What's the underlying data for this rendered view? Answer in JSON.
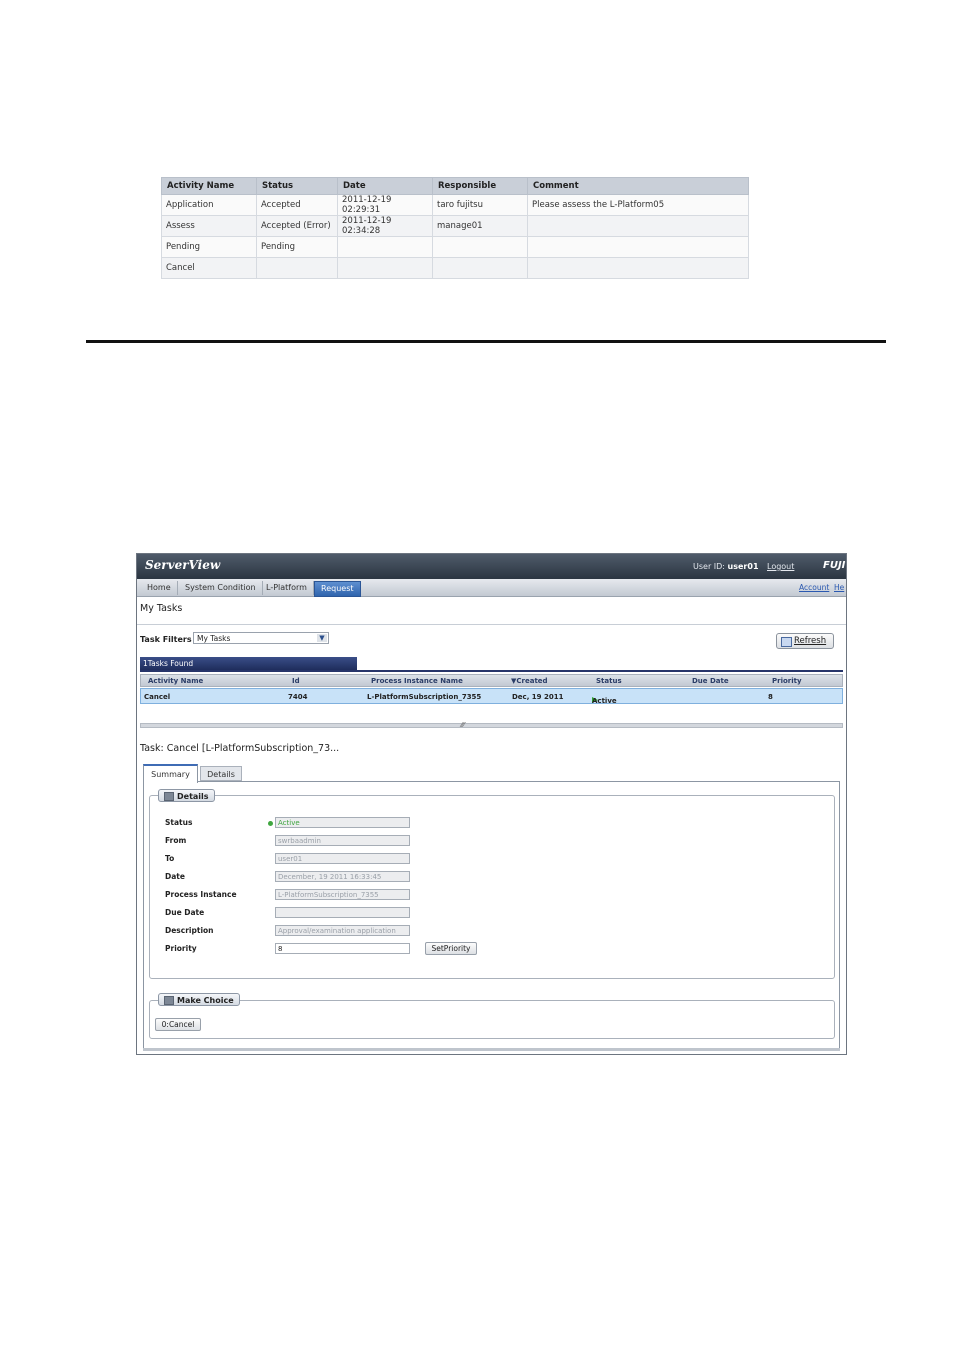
{
  "history": {
    "headers": [
      "Activity Name",
      "Status",
      "Date",
      "Responsible",
      "Comment"
    ],
    "rows": [
      [
        "Application",
        "Accepted",
        "2011-12-19 02:29:31",
        "taro fujitsu",
        "Please assess the L-Platform05"
      ],
      [
        "Assess",
        "Accepted (Error)",
        "2011-12-19 02:34:28",
        "manage01",
        ""
      ],
      [
        "Pending",
        "Pending",
        "",
        "",
        ""
      ],
      [
        "Cancel",
        "",
        "",
        "",
        ""
      ]
    ]
  },
  "app": {
    "logo": "ServerView",
    "user_label": "User ID:",
    "user_id": "user01",
    "logout": "Logout",
    "brand": "FUJITSU",
    "account": "Account",
    "help": "He"
  },
  "nav": {
    "tabs": [
      "Home",
      "System Condition",
      "L-Platform",
      "Request"
    ],
    "active": "Request"
  },
  "page_title": "My Tasks",
  "filter": {
    "label": "Task Filters",
    "value": "My Tasks"
  },
  "refresh_label": "Refresh",
  "found_label": "1Tasks Found",
  "grid": {
    "headers": [
      "Activity Name",
      "Id",
      "Process Instance Name",
      "▼Created",
      "Status",
      "Due Date",
      "Priority"
    ],
    "row": {
      "activity": "Cancel",
      "id": "7404",
      "process": "L-PlatformSubscription_7355",
      "created": "Dec, 19 2011",
      "status": "Active",
      "due": "",
      "priority": "8"
    }
  },
  "task_title": "Task: Cancel [L-PlatformSubscription_73...",
  "detail_tabs": [
    "Summary",
    "Details"
  ],
  "details": {
    "legend": "Details",
    "status_label": "Status",
    "status": "Active",
    "from_label": "From",
    "from": "swrbaadmin",
    "to_label": "To",
    "to": "user01",
    "date_label": "Date",
    "date": "December, 19 2011 16:33:45",
    "process_label": "Process Instance",
    "process": "L-PlatformSubscription_7355",
    "due_label": "Due Date",
    "due": "",
    "desc_label": "Description",
    "desc": "Approval/examination application",
    "priority_label": "Priority",
    "priority": "8",
    "set_priority": "SetPriority"
  },
  "choice": {
    "legend": "Make Choice",
    "button": "0:Cancel"
  },
  "colors": {
    "topbar": "#2b3541",
    "active_tab": "#2f64ad",
    "selected_row": "#c8e2f8",
    "active_status": "#2fa52f"
  }
}
